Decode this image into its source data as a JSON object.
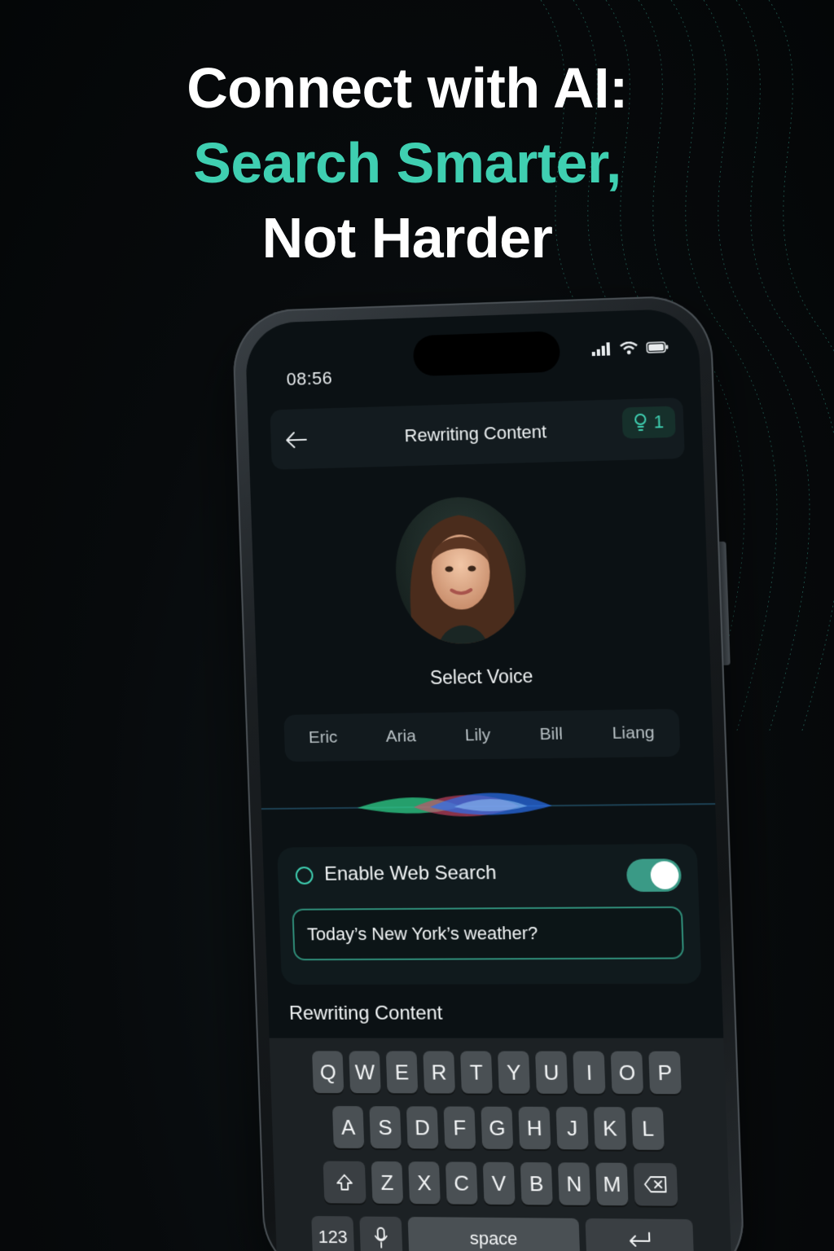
{
  "headline": {
    "line1": "Connect with AI:",
    "line2": "Search Smarter,",
    "line3": "Not Harder"
  },
  "colors": {
    "accent": "#3fcfb1",
    "background": "#06090b",
    "toggle_on": "#3a9a86"
  },
  "status_bar": {
    "time": "08:56",
    "icons": [
      "signal-icon",
      "wifi-icon",
      "battery-icon"
    ]
  },
  "top_bar": {
    "back_icon": "arrow-left-icon",
    "title": "Rewriting Content",
    "badge_icon": "lightbulb-icon",
    "badge_count": "1"
  },
  "voice": {
    "select_label": "Select Voice",
    "options": [
      "Eric",
      "Aria",
      "Lily",
      "Bill",
      "Liang"
    ]
  },
  "web_search": {
    "enable_label": "Enable Web Search",
    "enabled": true,
    "query_value": "Today’s New York’s weather?"
  },
  "section": {
    "label": "Rewriting Content"
  },
  "keyboard": {
    "row1": [
      "Q",
      "W",
      "E",
      "R",
      "T",
      "Y",
      "U",
      "I",
      "O",
      "P"
    ],
    "row2": [
      "A",
      "S",
      "D",
      "F",
      "G",
      "H",
      "J",
      "K",
      "L"
    ],
    "row3": [
      "Z",
      "X",
      "C",
      "V",
      "B",
      "N",
      "M"
    ],
    "numbers_key": "123",
    "space_key": "space",
    "shift_icon": "shift-icon",
    "delete_icon": "backspace-icon",
    "mic_icon": "microphone-icon",
    "enter_icon": "return-icon"
  }
}
